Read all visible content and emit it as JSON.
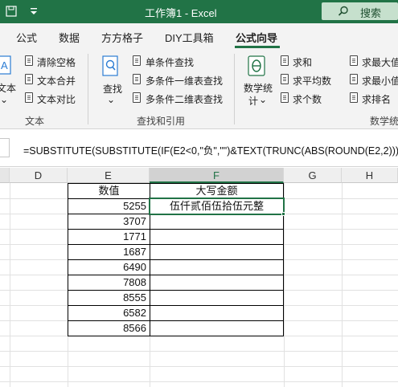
{
  "titlebar": {
    "title": "工作簿1  -  Excel",
    "search_label": "搜索",
    "accent_color": "#217346"
  },
  "tabs": [
    "公式",
    "数据",
    "方方格子",
    "DIY工具箱",
    "公式向导"
  ],
  "active_tab": "公式向导",
  "ribbon": {
    "text_group": {
      "big_button": "文本",
      "items": [
        "清除空格",
        "文本合并",
        "文本对比"
      ],
      "label": "文本"
    },
    "lookup_group": {
      "big_button": "查找",
      "items": [
        "单条件查找",
        "多条件一维表查找",
        "多条件二维表查找"
      ],
      "label": "查找和引用"
    },
    "math_group": {
      "big_button_line1": "数学统",
      "big_button_line2": "计",
      "items": [
        "求和",
        "求平均数",
        "求个数"
      ],
      "label": "数学统"
    },
    "stat_group": {
      "items": [
        "求最大值",
        "求最小值",
        "求排名"
      ]
    }
  },
  "formula_bar": {
    "formula": "=SUBSTITUTE(SUBSTITUTE(IF(E2<0,\"负\",\"\")&TEXT(TRUNC(ABS(ROUND(E2,2)))"
  },
  "columns": [
    "D",
    "E",
    "F",
    "G",
    "H"
  ],
  "selected_column": "F",
  "table": {
    "header_e": "数值",
    "header_f": "大写金额",
    "values": [
      "5255",
      "3707",
      "1771",
      "1687",
      "6490",
      "7808",
      "8555",
      "6582",
      "8566"
    ],
    "f2_value": "伍仟贰佰伍拾伍元整"
  }
}
